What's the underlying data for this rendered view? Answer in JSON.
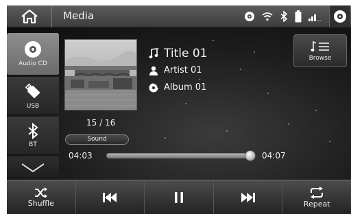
{
  "topbar": {
    "title": "Media",
    "home_icon": "home-icon",
    "status_icons": [
      "disc-icon",
      "wifi-icon",
      "bluetooth-icon",
      "battery-icon",
      "signal-icon"
    ],
    "power_icon": "power-icon"
  },
  "sources": [
    {
      "label": "Audio CD",
      "icon": "disc-icon",
      "active": true
    },
    {
      "label": "USB",
      "icon": "usb-icon",
      "active": false
    },
    {
      "label": "BT",
      "icon": "bluetooth-icon",
      "active": false
    }
  ],
  "now_playing": {
    "title": "Title 01",
    "artist": "Artist 01",
    "album": "Album 01",
    "track_position": "15 / 16"
  },
  "sound_label": "Sound",
  "browse_label": "Browse",
  "progress": {
    "elapsed": "04:03",
    "total": "04:07",
    "fraction": 0.984
  },
  "controls": {
    "shuffle_label": "Shuffle",
    "repeat_label": "Repeat"
  }
}
